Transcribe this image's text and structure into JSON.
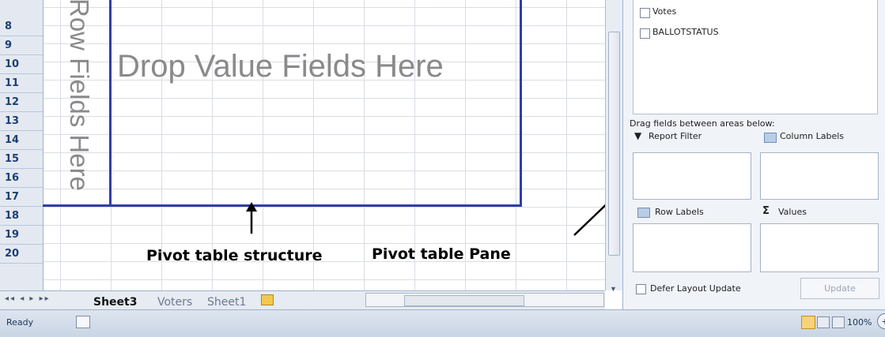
{
  "rows": [
    "8",
    "9",
    "10",
    "11",
    "12",
    "13",
    "14",
    "15",
    "16",
    "17",
    "18",
    "19",
    "20"
  ],
  "placeholders": {
    "drop_values": "Drop Value Fields Here",
    "drop_rows": "Row Fields Here"
  },
  "annotations": {
    "structure": "Pivot table structure",
    "pane": "Pivot table Pane"
  },
  "sheet_tabs": [
    "Sheet3",
    "Voters",
    "Sheet1"
  ],
  "field_list": [
    "Votes",
    "BALLOTSTATUS"
  ],
  "pane": {
    "instruction": "Drag fields between areas below:",
    "report_filter": "Report Filter",
    "column_labels": "Column Labels",
    "row_labels": "Row Labels",
    "values": "Values",
    "sigma": "Σ",
    "defer": "Defer Layout Update",
    "update": "Update"
  },
  "status": {
    "ready": "Ready",
    "zoom": "100%",
    "zoom_out": "−",
    "zoom_in": "+"
  },
  "icons": [
    "filter-icon",
    "column-labels-icon",
    "row-labels-icon",
    "values-sigma-icon",
    "sheet-nav-icons",
    "new-sheet-icon",
    "macro-record-icon",
    "zoom-out-icon",
    "zoom-in-icon"
  ],
  "colors": {
    "pivot_border": "#2f3ea8",
    "row_header_text": "#1d3f73",
    "placeholder_text": "#8a8a8a"
  }
}
